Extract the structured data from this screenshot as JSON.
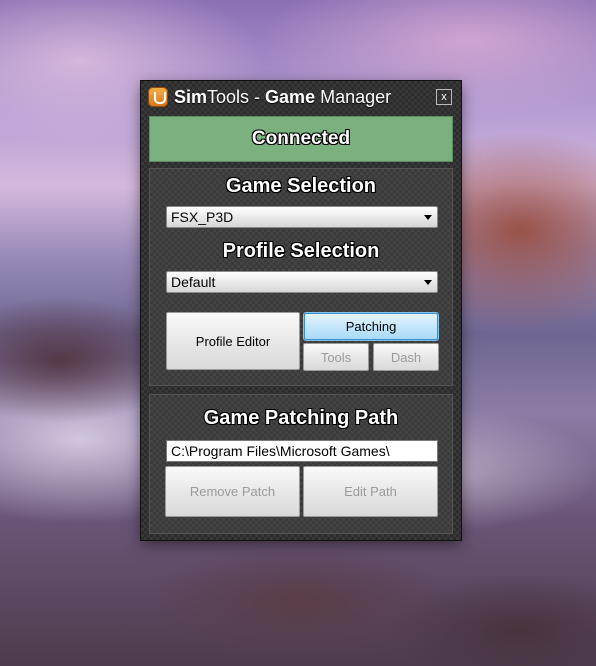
{
  "window": {
    "title_part1": "Sim",
    "title_part2": "Tools - ",
    "title_part3": "Game",
    "title_part4": " Manager",
    "close_label": "x"
  },
  "status": {
    "label": "Connected",
    "color": "#7bb07f"
  },
  "game_selection": {
    "heading": "Game Selection",
    "selected": "FSX_P3D"
  },
  "profile_selection": {
    "heading": "Profile Selection",
    "selected": "Default"
  },
  "buttons": {
    "profile_editor": "Profile Editor",
    "patching": "Patching",
    "tools": "Tools",
    "dash": "Dash",
    "remove_patch": "Remove Patch",
    "edit_path": "Edit Path"
  },
  "patching_path": {
    "heading": "Game Patching Path",
    "value": "C:\\Program Files\\Microsoft Games\\"
  },
  "icons": {
    "app": "simtools-app-icon",
    "close": "close-icon",
    "dropdown": "chevron-down-icon"
  }
}
